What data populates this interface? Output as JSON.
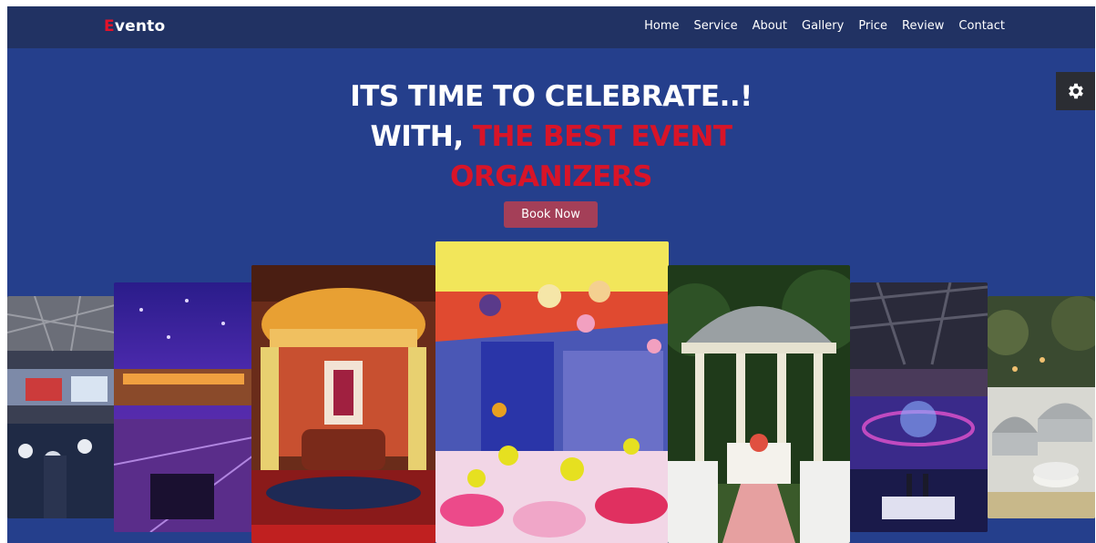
{
  "brand": {
    "logo_first": "E",
    "logo_rest": "vento",
    "accent": "#e3122a"
  },
  "nav": {
    "items": [
      "Home",
      "Service",
      "About",
      "Gallery",
      "Price",
      "Review",
      "Contact"
    ]
  },
  "settings": {
    "icon": "gear-icon"
  },
  "hero": {
    "line1": "ITS TIME TO CELEBRATE..!",
    "line2_white": "WITH,",
    "line2_red": "THE BEST EVENT",
    "line3_red": "ORGANIZERS",
    "button": "Book Now"
  },
  "gallery": {
    "slides": [
      "conference-hall-photo",
      "purple-lit-banquet-photo",
      "wedding-stage-photo",
      "balloon-party-photo",
      "garden-gazebo-photo",
      "concert-stage-photo",
      "buffet-catering-photo"
    ]
  },
  "colors": {
    "background": "#253f8c",
    "navbar": "#213263",
    "button": "#a43f58",
    "headline_red": "#d81428"
  }
}
